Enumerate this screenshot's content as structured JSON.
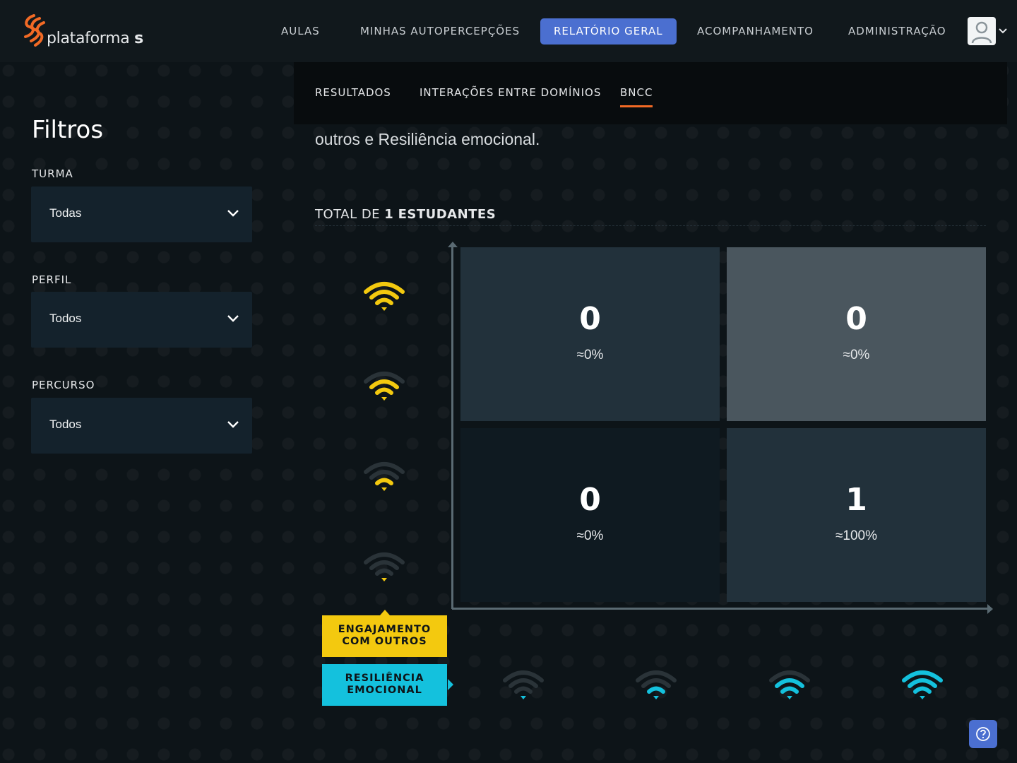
{
  "brand": {
    "name_prefix": "plataforma",
    "name_suffix": "s",
    "accent": "#f26a25"
  },
  "nav": {
    "items": [
      {
        "label": "AULAS",
        "active": false
      },
      {
        "label": "MINHAS AUTOPERCEPÇÕES",
        "active": false
      },
      {
        "label": "RELATÓRIO GERAL",
        "active": true
      },
      {
        "label": "ACOMPANHAMENTO",
        "active": false
      },
      {
        "label": "ADMINISTRAÇÃO",
        "active": false
      }
    ],
    "active_color": "#4b6fd0",
    "avatar_icon": "user-icon"
  },
  "sidebar": {
    "title": "Filtros",
    "filters": [
      {
        "label": "TURMA",
        "value": "Todas"
      },
      {
        "label": "PERFIL",
        "value": "Todos"
      },
      {
        "label": "PERCURSO",
        "value": "Todos"
      }
    ]
  },
  "subtabs": [
    {
      "label": "RESULTADOS",
      "active": false
    },
    {
      "label": "INTERAÇÕES ENTRE DOMÍNIOS",
      "active": false
    },
    {
      "label": "BNCC",
      "active": true
    }
  ],
  "content": {
    "intro_text": "outros e Resiliência emocional.",
    "total_prefix": "TOTAL DE",
    "total_count": "1",
    "total_suffix": "ESTUDANTES"
  },
  "matrix": {
    "cells": [
      {
        "count": "0",
        "percent": "≈0%",
        "color": "#22313b"
      },
      {
        "count": "0",
        "percent": "≈0%",
        "color": "#4a565e"
      },
      {
        "count": "0",
        "percent": "≈0%",
        "color": "#0f1a21"
      },
      {
        "count": "1",
        "percent": "≈100%",
        "color": "#22313b"
      }
    ],
    "y_axis_levels": [
      4,
      3,
      2,
      1
    ],
    "x_axis_levels": [
      1,
      2,
      3,
      4
    ],
    "y_color": "#f3c90f",
    "x_color": "#14c1dd",
    "inactive_color": "#2a3338"
  },
  "legend": {
    "engajamento": "ENGAJAMENTO COM OUTROS",
    "engajamento_line1": "ENGAJAMENTO",
    "engajamento_line2": "COM OUTROS",
    "resiliencia_line1": "RESILIÊNCIA",
    "resiliencia_line2": "EMOCIONAL"
  },
  "help": {
    "icon": "help-icon"
  }
}
